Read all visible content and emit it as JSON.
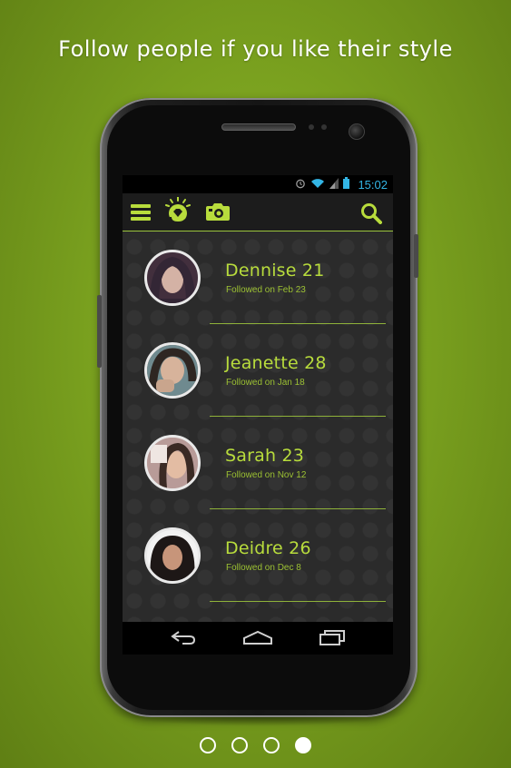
{
  "headline": "Follow people if you like their style",
  "status_bar": {
    "time": "15:02",
    "icons": [
      "alarm-icon",
      "wifi-icon",
      "signal-icon",
      "battery-icon"
    ]
  },
  "app_bar": {
    "icons": [
      "menu-icon",
      "diamond-bulb-logo-icon",
      "camera-icon",
      "search-icon"
    ]
  },
  "followed": [
    {
      "name": "Dennise 21",
      "followed_on": "Followed on Feb 23"
    },
    {
      "name": "Jeanette 28",
      "followed_on": "Followed on Jan 18"
    },
    {
      "name": "Sarah 23",
      "followed_on": "Followed on Nov 12"
    },
    {
      "name": "Deidre 26",
      "followed_on": "Followed on Dec 8"
    }
  ],
  "nav_bar": {
    "icons": [
      "back-icon",
      "home-icon",
      "recents-icon"
    ]
  },
  "pager": {
    "count": 4,
    "active_index": 3
  },
  "colors": {
    "accent": "#b8dc3c",
    "background": "#7aa11f",
    "status_blue": "#33b5e5"
  }
}
